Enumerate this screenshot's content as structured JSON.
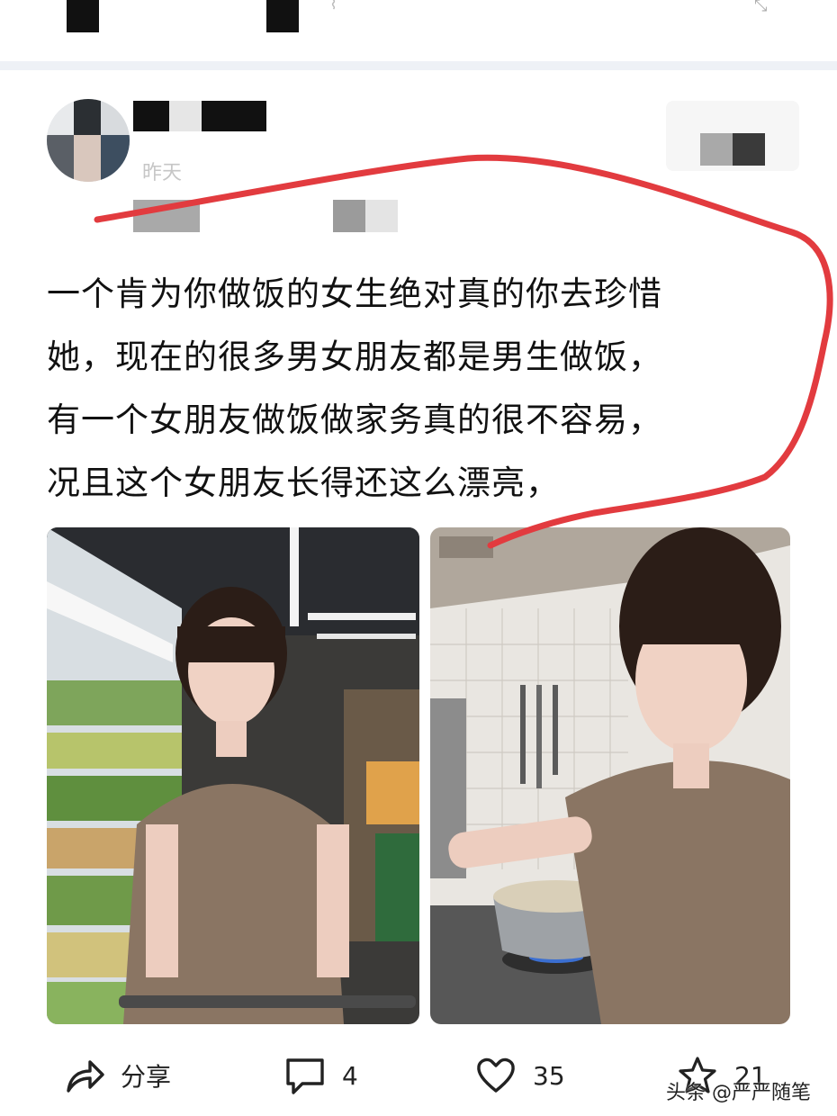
{
  "post": {
    "time": "昨天",
    "lines": [
      "一个肯为你做饭的女生绝对真的你去珍惜",
      "她，现在的很多男女朋友都是男生做饭，",
      "有一个女朋友做饭做家务真的很不容易，",
      "况且这个女朋友长得还这么漂亮，"
    ]
  },
  "images": [
    {
      "icon": "supermarket-photo"
    },
    {
      "icon": "kitchen-photo"
    }
  ],
  "actions": {
    "share_label": "分享",
    "comment_count": "4",
    "like_count": "35",
    "favorite_count": "21"
  },
  "watermark": "头条 @严严随笔",
  "colors": {
    "annotation": "#e23b3f",
    "divider": "#eef1f6",
    "text": "#111111"
  }
}
